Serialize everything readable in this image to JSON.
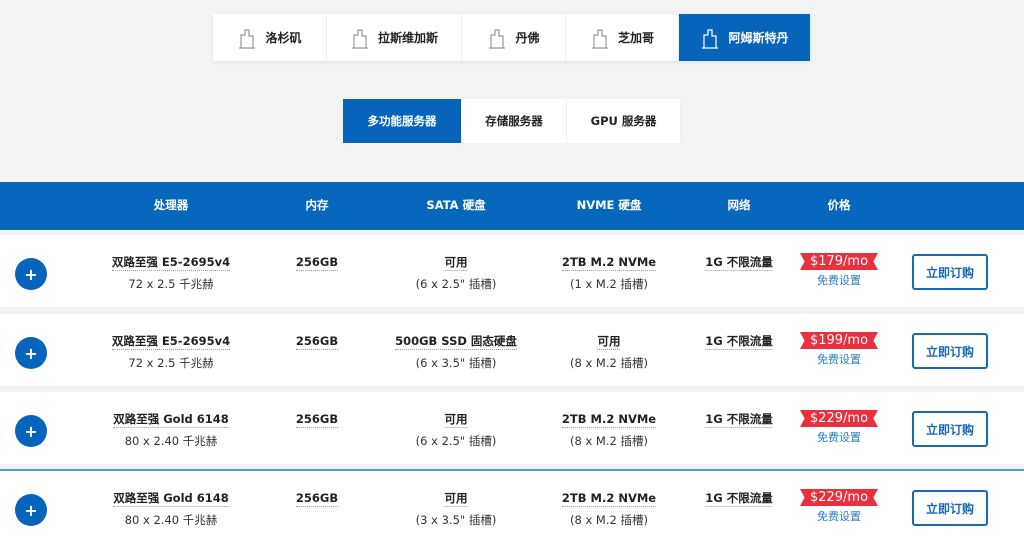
{
  "cities": [
    {
      "label": "洛杉矶",
      "icon": "city-skyline-icon"
    },
    {
      "label": "拉斯维加斯",
      "icon": "city-skyline-icon"
    },
    {
      "label": "丹佛",
      "icon": "mountain-city-icon"
    },
    {
      "label": "芝加哥",
      "icon": "tower-icon"
    },
    {
      "label": "阿姆斯特丹",
      "icon": "tower-icon",
      "active": true
    }
  ],
  "types": [
    {
      "label": "多功能服务器",
      "active": true
    },
    {
      "label": "存储服务器"
    },
    {
      "label": "GPU 服务器"
    }
  ],
  "headers": [
    "处理器",
    "内存",
    "SATA 硬盘",
    "NVME 硬盘",
    "网络",
    "价格"
  ],
  "rows": [
    {
      "cpu": "双路至强 E5-2695v4",
      "cores": "72 x 2.5 千兆赫",
      "ram": "256GB",
      "sata": "可用",
      "sata_sub": "(6 x 2.5\" 插槽)",
      "nvme": "2TB M.2 NVMe",
      "nvme_sub": "(1 x M.2 插槽)",
      "net": "1G 不限流量",
      "price": "$179/mo",
      "setup": "免费设置",
      "order": "立即订购"
    },
    {
      "cpu": "双路至强 E5-2695v4",
      "cores": "72 x 2.5 千兆赫",
      "ram": "256GB",
      "sata": "500GB SSD 固态硬盘",
      "sata_sub": "(6 x 3.5\" 插槽)",
      "nvme": "可用",
      "nvme_sub": "(8 x M.2 插槽)",
      "net": "1G 不限流量",
      "price": "$199/mo",
      "setup": "免费设置",
      "order": "立即订购"
    },
    {
      "cpu": "双路至强 Gold 6148",
      "cores": "80 x 2.40 千兆赫",
      "ram": "256GB",
      "sata": "可用",
      "sata_sub": "(6 x 2.5\" 插槽)",
      "nvme": "2TB M.2 NVMe",
      "nvme_sub": "(8 x M.2 插槽)",
      "net": "1G 不限流量",
      "price": "$229/mo",
      "setup": "免费设置",
      "order": "立即订购"
    },
    {
      "cpu": "双路至强 Gold 6148",
      "cores": "80 x 2.40 千兆赫",
      "ram": "256GB",
      "sata": "可用",
      "sata_sub": "(3 x 3.5\" 插槽)",
      "nvme": "2TB M.2 NVMe",
      "nvme_sub": "(8 x M.2 插槽)",
      "net": "1G 不限流量",
      "price": "$229/mo",
      "setup": "免费设置",
      "order": "立即订购"
    }
  ]
}
